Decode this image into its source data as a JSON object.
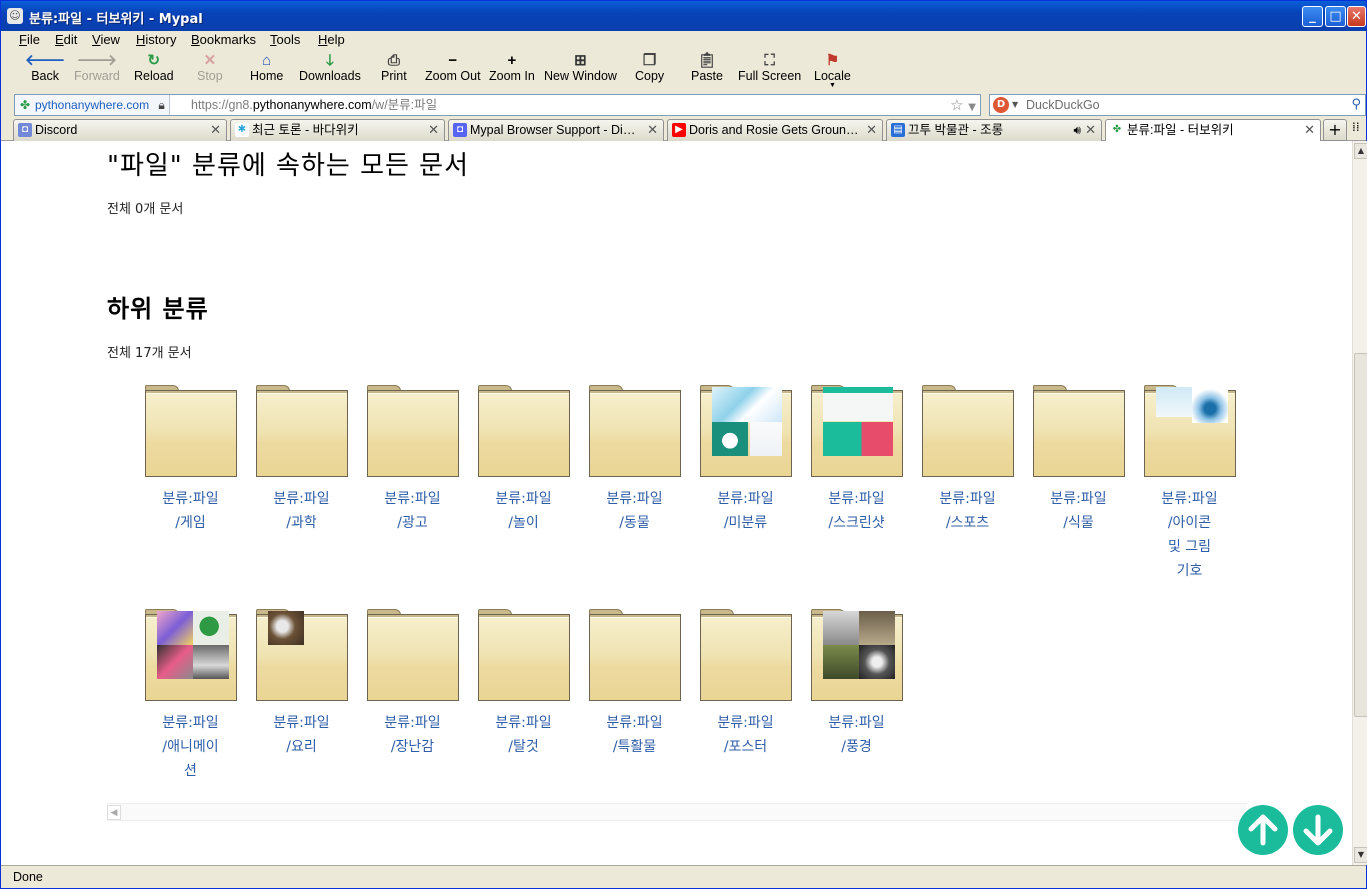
{
  "window": {
    "title": "분류:파일 - 터보위키 - Mypal",
    "minimize": "_",
    "maximize": "□",
    "close": "✕"
  },
  "menu": [
    "File",
    "Edit",
    "View",
    "History",
    "Bookmarks",
    "Tools",
    "Help"
  ],
  "toolbar": {
    "back": "Back",
    "forward": "Forward",
    "reload": "Reload",
    "stop": "Stop",
    "home": "Home",
    "downloads": "Downloads",
    "print": "Print",
    "zoom_out": "Zoom Out",
    "zoom_in": "Zoom In",
    "new_window": "New Window",
    "copy": "Copy",
    "paste": "Paste",
    "full_screen": "Full Screen",
    "locale": "Locale"
  },
  "urlbar": {
    "identity": "pythonanywhere.com",
    "url_prefix": "https://gn8.",
    "url_domain": "pythonanywhere.com",
    "url_path": "/w/분류:파일"
  },
  "search": {
    "placeholder": "DuckDuckGo"
  },
  "tabs": [
    {
      "title": "Discord",
      "fav_color": "#7289da"
    },
    {
      "title": "최근 토론 - 바다위키",
      "fav_color": "#2aa6d8"
    },
    {
      "title": "Mypal Browser Support - Di…",
      "fav_color": "#5865f2"
    },
    {
      "title": "Doris and Rosie Gets Groun…",
      "fav_color": "#ff0000"
    },
    {
      "title": "끄투 박물관 - 조롱",
      "fav_color": "#2a6fd8"
    },
    {
      "title": "분류:파일 - 터보위키",
      "fav_color": "#2a9b47"
    }
  ],
  "page": {
    "heading": "\"파일\" 분류에 속하는 모든 문서",
    "doc_count": "전체 0개 문서",
    "sub_heading": "하위 분류",
    "sub_count": "전체 17개 문서",
    "categories": [
      {
        "line1": "분류:파일",
        "line2": "/게임",
        "line3": "",
        "line4": ""
      },
      {
        "line1": "분류:파일",
        "line2": "/과학",
        "line3": "",
        "line4": ""
      },
      {
        "line1": "분류:파일",
        "line2": "/광고",
        "line3": "",
        "line4": ""
      },
      {
        "line1": "분류:파일",
        "line2": "/놀이",
        "line3": "",
        "line4": ""
      },
      {
        "line1": "분류:파일",
        "line2": "/동물",
        "line3": "",
        "line4": ""
      },
      {
        "line1": "분류:파일",
        "line2": "/미분류",
        "line3": "",
        "line4": ""
      },
      {
        "line1": "분류:파일",
        "line2": "/스크린샷",
        "line3": "",
        "line4": ""
      },
      {
        "line1": "분류:파일",
        "line2": "/스포츠",
        "line3": "",
        "line4": ""
      },
      {
        "line1": "분류:파일",
        "line2": "/식물",
        "line3": "",
        "line4": ""
      },
      {
        "line1": "분류:파일",
        "line2": "/아이콘",
        "line3": "및 그림",
        "line4": "기호"
      },
      {
        "line1": "분류:파일",
        "line2": "/애니메이",
        "line3": "션",
        "line4": ""
      },
      {
        "line1": "분류:파일",
        "line2": "/요리",
        "line3": "",
        "line4": ""
      },
      {
        "line1": "분류:파일",
        "line2": "/장난감",
        "line3": "",
        "line4": ""
      },
      {
        "line1": "분류:파일",
        "line2": "/탈것",
        "line3": "",
        "line4": ""
      },
      {
        "line1": "분류:파일",
        "line2": "/특활물",
        "line3": "",
        "line4": ""
      },
      {
        "line1": "분류:파일",
        "line2": "/포스터",
        "line3": "",
        "line4": ""
      },
      {
        "line1": "분류:파일",
        "line2": "/풍경",
        "line3": "",
        "line4": ""
      }
    ]
  },
  "status": "Done",
  "colors": {
    "link": "#2f5ea8",
    "scroll_button": "#1abc9c",
    "titlebar": "#0842b8"
  }
}
